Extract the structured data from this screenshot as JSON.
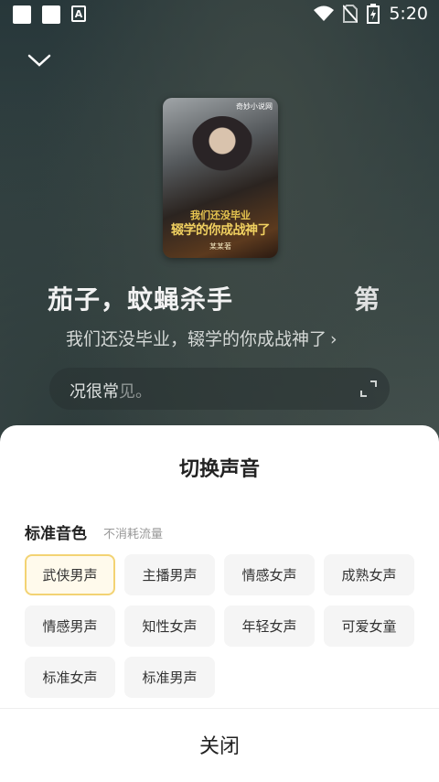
{
  "status_bar": {
    "time": "5:20",
    "icons": [
      "notification-square-icon",
      "notification-square-icon",
      "font-a-icon",
      "wifi-icon",
      "no-sim-icon",
      "battery-charging-icon"
    ]
  },
  "player": {
    "collapse_icon": "chevron-down-icon",
    "cover": {
      "logo": "奇妙小说网",
      "title_line1": "我们还没毕业",
      "title_line2": "辍学的你成战神了",
      "author": "某某著"
    },
    "lyric_current_a": "茄子，蚊蝇杀手",
    "lyric_current_b": "第",
    "book_title": "我们还没毕业，辍学的你成战神了",
    "book_arrow": "›",
    "text_preview_a": "况很常",
    "text_preview_b": "见。"
  },
  "sheet": {
    "title": "切换声音",
    "section_title": "标准音色",
    "section_sub": "不消耗流量",
    "voices": [
      "武侠男声",
      "主播男声",
      "情感女声",
      "成熟女声",
      "情感男声",
      "知性女声",
      "年轻女声",
      "可爱女童",
      "标准女声",
      "标准男声"
    ],
    "selected_index": 0,
    "close_label": "关闭"
  },
  "colors": {
    "selected_border": "#f3d373",
    "selected_bg": "#fffaec",
    "chip_bg": "#f5f5f5"
  }
}
